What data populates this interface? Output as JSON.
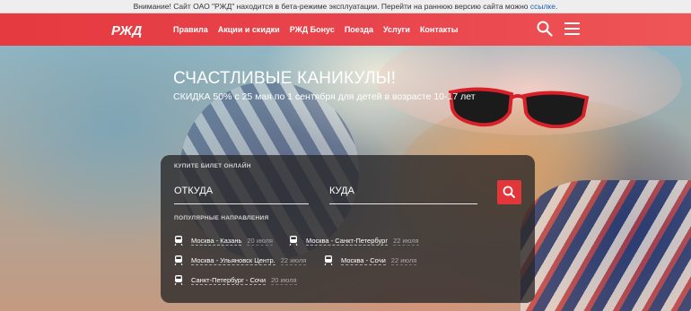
{
  "beta_notice": {
    "text": "Внимание! Сайт ОАО \"РЖД\" находится в бета-режиме эксплуатации. Перейти на раннюю версию сайта можно ",
    "link": "ссылке",
    "end": "."
  },
  "header": {
    "logo": "РЖД",
    "nav": [
      "Правила",
      "Акции и скидки",
      "РЖД Бонус",
      "Поезда",
      "Услуги",
      "Контакты"
    ],
    "colors": {
      "accent": "#e53a3f"
    }
  },
  "promo": {
    "title": "СЧАСТЛИВЫЕ КАНИКУЛЫ!",
    "subtitle": "СКИДКА 50% с 25 мая по 1 сентября для детей в возрасте 10-17 лет"
  },
  "ticket": {
    "label": "КУПИТЕ БИЛЕТ ОНЛАЙН",
    "from": "ОТКУДА",
    "to": "КУДА",
    "popular_label": "ПОПУЛЯРНЫЕ НАПРАВЛЕНИЯ",
    "routes": [
      {
        "name": "Москва - Казань",
        "date": "20 июля"
      },
      {
        "name": "Москва - Санкт-Петербург",
        "date": "22 июля"
      },
      {
        "name": "Москва - Ульяновск Центр.",
        "date": "22 июля"
      },
      {
        "name": "Москва - Сочи",
        "date": "22 июля"
      },
      {
        "name": "Санкт-Петербург - Сочи",
        "date": "20 июля"
      }
    ]
  }
}
